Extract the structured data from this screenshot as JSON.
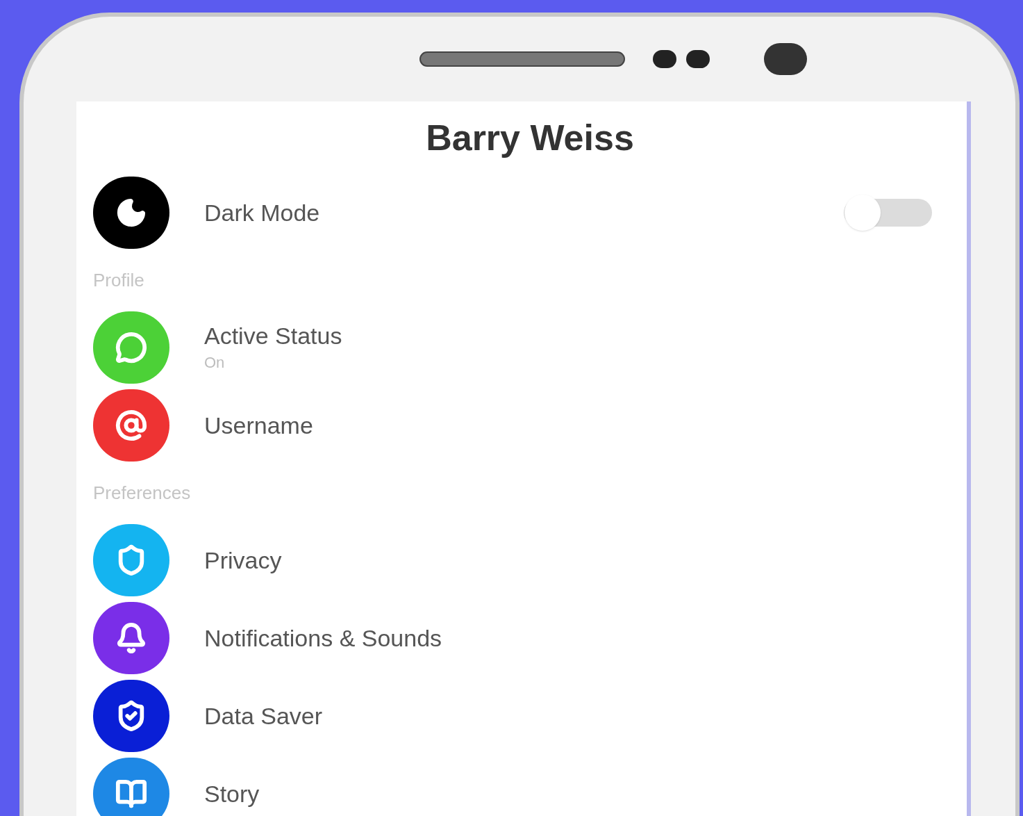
{
  "screen": {
    "title": "Barry Weiss"
  },
  "items": [
    {
      "kind": "toggle",
      "label": "Dark Mode",
      "color": "#000000",
      "on": false
    },
    {
      "kind": "header",
      "label": "Profile"
    },
    {
      "kind": "link",
      "label": "Active Status",
      "subtitle": "On",
      "color": "#4cd137"
    },
    {
      "kind": "link",
      "label": "Username",
      "color": "#ee3333"
    },
    {
      "kind": "header",
      "label": "Preferences"
    },
    {
      "kind": "link",
      "label": "Privacy",
      "color": "#14b4f0"
    },
    {
      "kind": "link",
      "label": "Notifications & Sounds",
      "color": "#7a2ee8"
    },
    {
      "kind": "link",
      "label": "Data Saver",
      "color": "#0a1fd6"
    },
    {
      "kind": "link",
      "label": "Story",
      "color": "#1e88e5"
    }
  ]
}
